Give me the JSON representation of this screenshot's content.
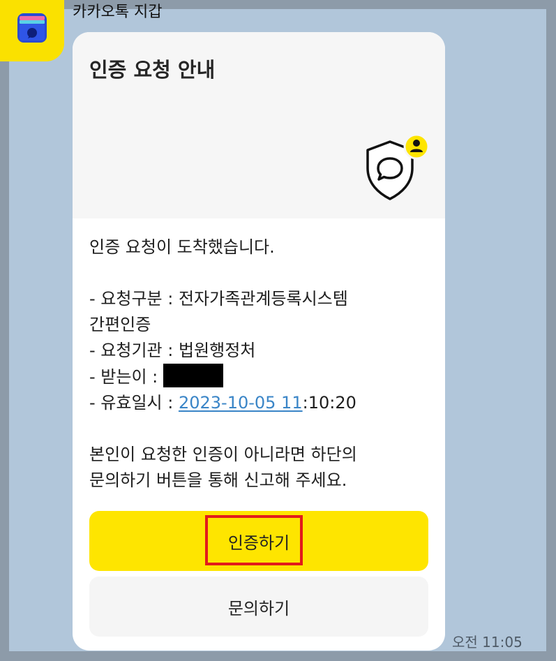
{
  "chat": {
    "sender_name": "카카오톡 지갑",
    "timestamp": "오전 11:05"
  },
  "card": {
    "title": "인증 요청 안내",
    "lines": {
      "greeting": "인증 요청이 도착했습니다.",
      "type_line1": "- 요청구분 : 전자가족관계등록시스템",
      "type_line2": "간편인증",
      "agency": "- 요청기관 : 법원행정처",
      "recipient_label": "- 받는이 : ",
      "valid_label": "- 유효일시 : ",
      "valid_link": "2023-10-05 11",
      "valid_rest": ":10:20",
      "notice_line1": "본인이 요청한 인증이 아니라면 하단의",
      "notice_line2": "문의하기 버튼을 통해 신고해 주세요."
    },
    "buttons": {
      "authenticate": "인증하기",
      "inquiry": "문의하기"
    }
  },
  "colors": {
    "kakao_yellow": "#fee500",
    "chat_background": "#b1c6da",
    "link_blue": "#3a85c7",
    "highlight_red": "#e21b1b"
  },
  "icons": {
    "avatar": "wallet-icon",
    "header": "shield-chat-icon",
    "badge": "person-badge-icon"
  }
}
